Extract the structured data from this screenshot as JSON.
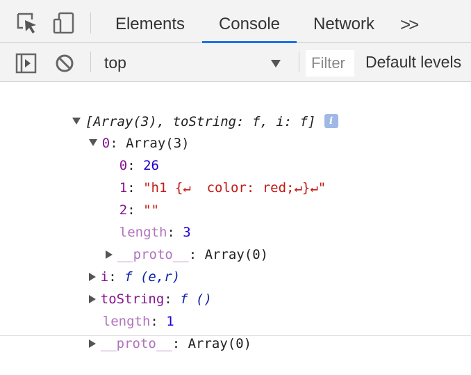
{
  "tabs": {
    "elements": "Elements",
    "console": "Console",
    "network": "Network",
    "more": ">>"
  },
  "toolbar": {
    "context": "top",
    "filter_placeholder": "Filter",
    "levels": "Default levels"
  },
  "console": {
    "summary": "[Array(3), toString: f, i: f]",
    "info_badge": "i",
    "item0": {
      "key": "0",
      "sep": ": ",
      "value": "Array(3)"
    },
    "item0_children": [
      {
        "key": "0",
        "sep": ": ",
        "value": "26"
      },
      {
        "key": "1",
        "sep": ": ",
        "value": "\"h1 {↵  color: red;↵}↵\""
      },
      {
        "key": "2",
        "sep": ": ",
        "value": "\"\""
      },
      {
        "key": "length",
        "sep": ": ",
        "value": "3"
      }
    ],
    "item0_proto": {
      "key": "__proto__",
      "sep": ": ",
      "value": "Array(0)"
    },
    "prop_i": {
      "key": "i",
      "sep": ": ",
      "value": "f (e,r)"
    },
    "prop_tostring": {
      "key": "toString",
      "sep": ": ",
      "value": "f ()"
    },
    "prop_length": {
      "key": "length",
      "sep": ": ",
      "value": "1"
    },
    "proto": {
      "key": "__proto__",
      "sep": ": ",
      "value": "Array(0)"
    }
  },
  "colors": {
    "accent": "#1a73e8",
    "key": "#881391",
    "number": "#1c00cf",
    "string": "#c41a16"
  }
}
